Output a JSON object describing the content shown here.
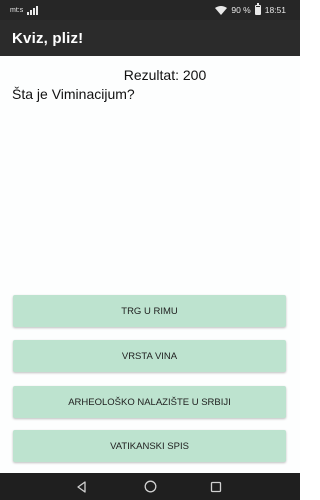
{
  "status_bar": {
    "carrier": "mt:s",
    "battery_percent": "90 %",
    "time": "18:51",
    "battery_level": 0.9
  },
  "app_bar": {
    "title": "Kviz, pliz!"
  },
  "quiz": {
    "score": "Rezultat: 200",
    "question": "Šta je Viminacijum?",
    "answers": [
      "TRG U RIMU",
      "VRSTA VINA",
      "ARHEOLOŠKO NALAZIŠTE U SRBIJI",
      "VATIKANSKI SPIS"
    ]
  },
  "nav_bar": {
    "icons": [
      "back-icon",
      "home-icon",
      "recents-icon"
    ]
  },
  "colors": {
    "button_bg": "#bde3cf",
    "app_bar_bg": "#2b2b2b",
    "status_bar_bg": "#262626"
  }
}
